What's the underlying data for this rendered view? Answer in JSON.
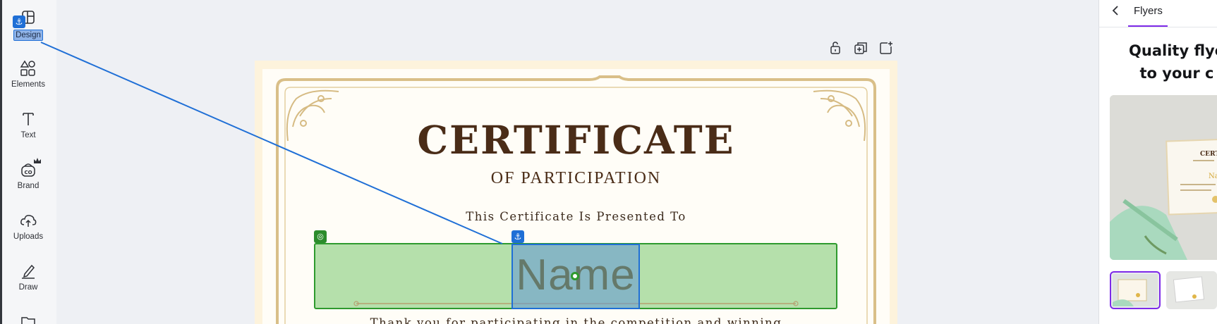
{
  "sidebar": {
    "items": [
      {
        "label": "Design",
        "icon": "design-icon"
      },
      {
        "label": "Elements",
        "icon": "elements-icon"
      },
      {
        "label": "Text",
        "icon": "text-icon"
      },
      {
        "label": "Brand",
        "icon": "brand-icon"
      },
      {
        "label": "Uploads",
        "icon": "uploads-icon"
      },
      {
        "label": "Draw",
        "icon": "draw-icon"
      },
      {
        "label": "",
        "icon": "folder-icon"
      }
    ],
    "brand_badge": "crown-icon"
  },
  "toolbar": {
    "icons": [
      "lock-icon",
      "duplicate-icon",
      "add-page-icon"
    ]
  },
  "certificate": {
    "title": "CERTIFICATE",
    "subtitle": "OF PARTICIPATION",
    "presented": "This Certificate Is Presented To",
    "name": "Name",
    "thanks": "Thank you for participating in the competition and winning"
  },
  "overlay": {
    "anchor_glyph": "⚓",
    "target_glyph": "◎",
    "colors": {
      "selection": "#1f6fd6",
      "target": "#2e9a2e"
    }
  },
  "panel": {
    "back_icon": "chevron-left-icon",
    "tab": "Flyers",
    "heading_line1": "Quality flye",
    "heading_line2": "to your c",
    "accent": "#7d2ae8"
  }
}
